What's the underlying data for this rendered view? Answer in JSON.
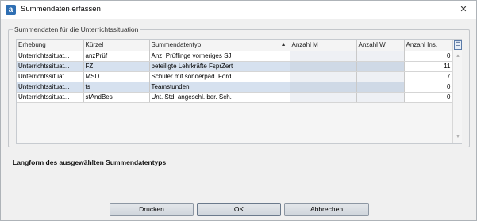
{
  "window": {
    "icon_letter": "a",
    "title": "Summendaten erfassen",
    "close_glyph": "✕"
  },
  "group": {
    "legend": "Summendaten für die Unterrichtssituation"
  },
  "table": {
    "columns": [
      "Erhebung",
      "Kürzel",
      "Summendatentyp",
      "Anzahl M",
      "Anzahl W",
      "Anzahl Ins."
    ],
    "sorted_column": "Summendatentyp",
    "sort_direction": "ascending",
    "rows": [
      {
        "erhebung": "Unterrichtssituat...",
        "kuerzel": "anzPrüf",
        "typ": "Anz. Prüflinge vorheriges SJ",
        "m": "",
        "w": "",
        "ins": "0",
        "selected": false
      },
      {
        "erhebung": "Unterrichtssituat...",
        "kuerzel": "FZ",
        "typ": "beteiligte Lehrkräfte FsprZert",
        "m": "",
        "w": "",
        "ins": "11",
        "selected": true
      },
      {
        "erhebung": "Unterrichtssituat...",
        "kuerzel": "MSD",
        "typ": "Schüler mit sonderpäd. Förd.",
        "m": "",
        "w": "",
        "ins": "7",
        "selected": false
      },
      {
        "erhebung": "Unterrichtssituat...",
        "kuerzel": "ts",
        "typ": "Teamstunden",
        "m": "",
        "w": "",
        "ins": "0",
        "selected": true
      },
      {
        "erhebung": "Unterrichtssituat...",
        "kuerzel": "stAndBes",
        "typ": "Unt. Std. angeschl. ber. Sch.",
        "m": "",
        "w": "",
        "ins": "0",
        "selected": false
      }
    ]
  },
  "longform": {
    "label": "Langform des ausgewählten Summendatentyps"
  },
  "buttons": {
    "print": "Drucken",
    "ok": "OK",
    "cancel": "Abbrechen"
  },
  "colors": {
    "selected_row": "#d6e1ef",
    "accent_icon": "#2f6fb3"
  }
}
